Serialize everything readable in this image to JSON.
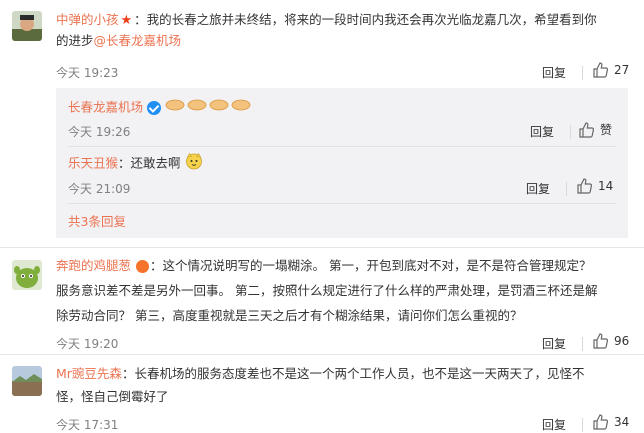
{
  "comments": [
    {
      "username": "中弹的小孩",
      "text_line1": "：我的长春之旅并未终结，将来的一段时间内我还会再次光临龙嘉几次，希望看到你",
      "text_line2_prefix": "的进步",
      "mention": "@长春龙嘉机场",
      "time": "今天 19:23",
      "reply_label": "回复",
      "likes": "27",
      "replies": [
        {
          "username": "长春龙嘉机场",
          "text": "",
          "time": "今天 19:26",
          "reply_label": "回复",
          "likes": "赞"
        },
        {
          "username": "乐天丑猴",
          "text": "：还敢去啊",
          "time": "今天 21:09",
          "reply_label": "回复",
          "likes": "14"
        }
      ],
      "more_replies": "共3条回复"
    },
    {
      "username": "奔跑的鸡腿葱",
      "text_line1": "：这个情况说明写的一塌糊涂。 第一，开包到底对不对，是不是符合管理规定？",
      "text_line2": "服务意识差不差是另外一回事。 第二，按照什么规定进行了什么样的严肃处理，是罚酒三杯还是解",
      "text_line3": "除劳动合同？ 第三，高度重视就是三天之后才有个糊涂结果，请问你们怎么重视的？",
      "time": "今天 19:20",
      "reply_label": "回复",
      "likes": "96"
    },
    {
      "username": "Mr豌豆先森",
      "text_line1": "：长春机场的服务态度差也不是这一个两个工作人员，也不是这一天两天了，见怪不",
      "text_line2": "怪，怪自己倒霉好了",
      "time": "今天 17:31",
      "reply_label": "回复",
      "likes": "34"
    }
  ],
  "colors": {
    "username": "#eb7350",
    "reply_bg": "#f2f2f5",
    "time": "#808080"
  }
}
